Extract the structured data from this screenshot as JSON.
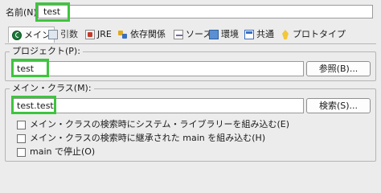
{
  "name": {
    "label": "名前(N)",
    "value": "test"
  },
  "tabs": [
    {
      "label": "メイン",
      "icon": "main-icon"
    },
    {
      "label": "引数",
      "icon": "arguments-icon"
    },
    {
      "label": "JRE",
      "icon": "jre-icon"
    },
    {
      "label": "依存関係",
      "icon": "dependencies-icon"
    },
    {
      "label": "ソース",
      "icon": "source-icon"
    },
    {
      "label": "環境",
      "icon": "environment-icon"
    },
    {
      "label": "共通",
      "icon": "common-icon"
    },
    {
      "label": "プロトタイプ",
      "icon": "prototype-icon"
    }
  ],
  "project": {
    "legend": "プロジェクト(P):",
    "value": "test",
    "browse_label": "参照(B)..."
  },
  "main_class": {
    "legend": "メイン・クラス(M):",
    "value": "test.test",
    "search_label": "検索(S)...",
    "options": [
      {
        "label": "メイン・クラスの検索時にシステム・ライブラリーを組み込む(E)",
        "checked": false
      },
      {
        "label": "メイン・クラスの検索時に継承された main を組み込む(H)",
        "checked": false
      },
      {
        "label": "main で停止(O)",
        "checked": false
      }
    ]
  },
  "colors": {
    "highlight": "#3ec43e",
    "active_tab_icon": "#1f7a3a"
  }
}
